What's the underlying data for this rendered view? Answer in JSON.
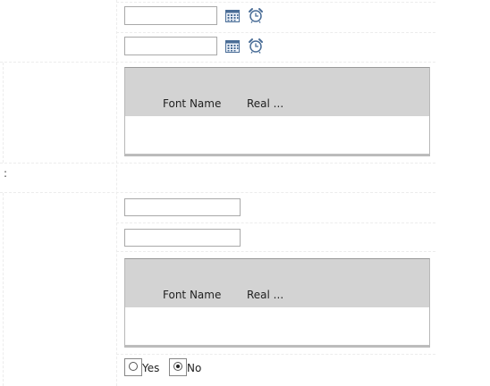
{
  "form": {
    "datetime_fields": [
      {
        "value": ""
      },
      {
        "value": ""
      }
    ],
    "grids": [
      {
        "columns": [
          "Font Name",
          "Real ..."
        ]
      },
      {
        "columns": [
          "Font Name",
          "Real ..."
        ]
      }
    ],
    "text_fields": [
      {
        "value": ""
      },
      {
        "value": ""
      }
    ],
    "row_marker": ":",
    "yes_no": {
      "options": [
        "Yes",
        "No"
      ],
      "selected": "No"
    }
  },
  "icons": {
    "calendar": "calendar-icon",
    "clock": "alarm-clock-icon"
  },
  "colors": {
    "grid_header": "#d3d3d3",
    "icon_blue": "#4a6d97",
    "field_border": "#a9a9a9"
  }
}
